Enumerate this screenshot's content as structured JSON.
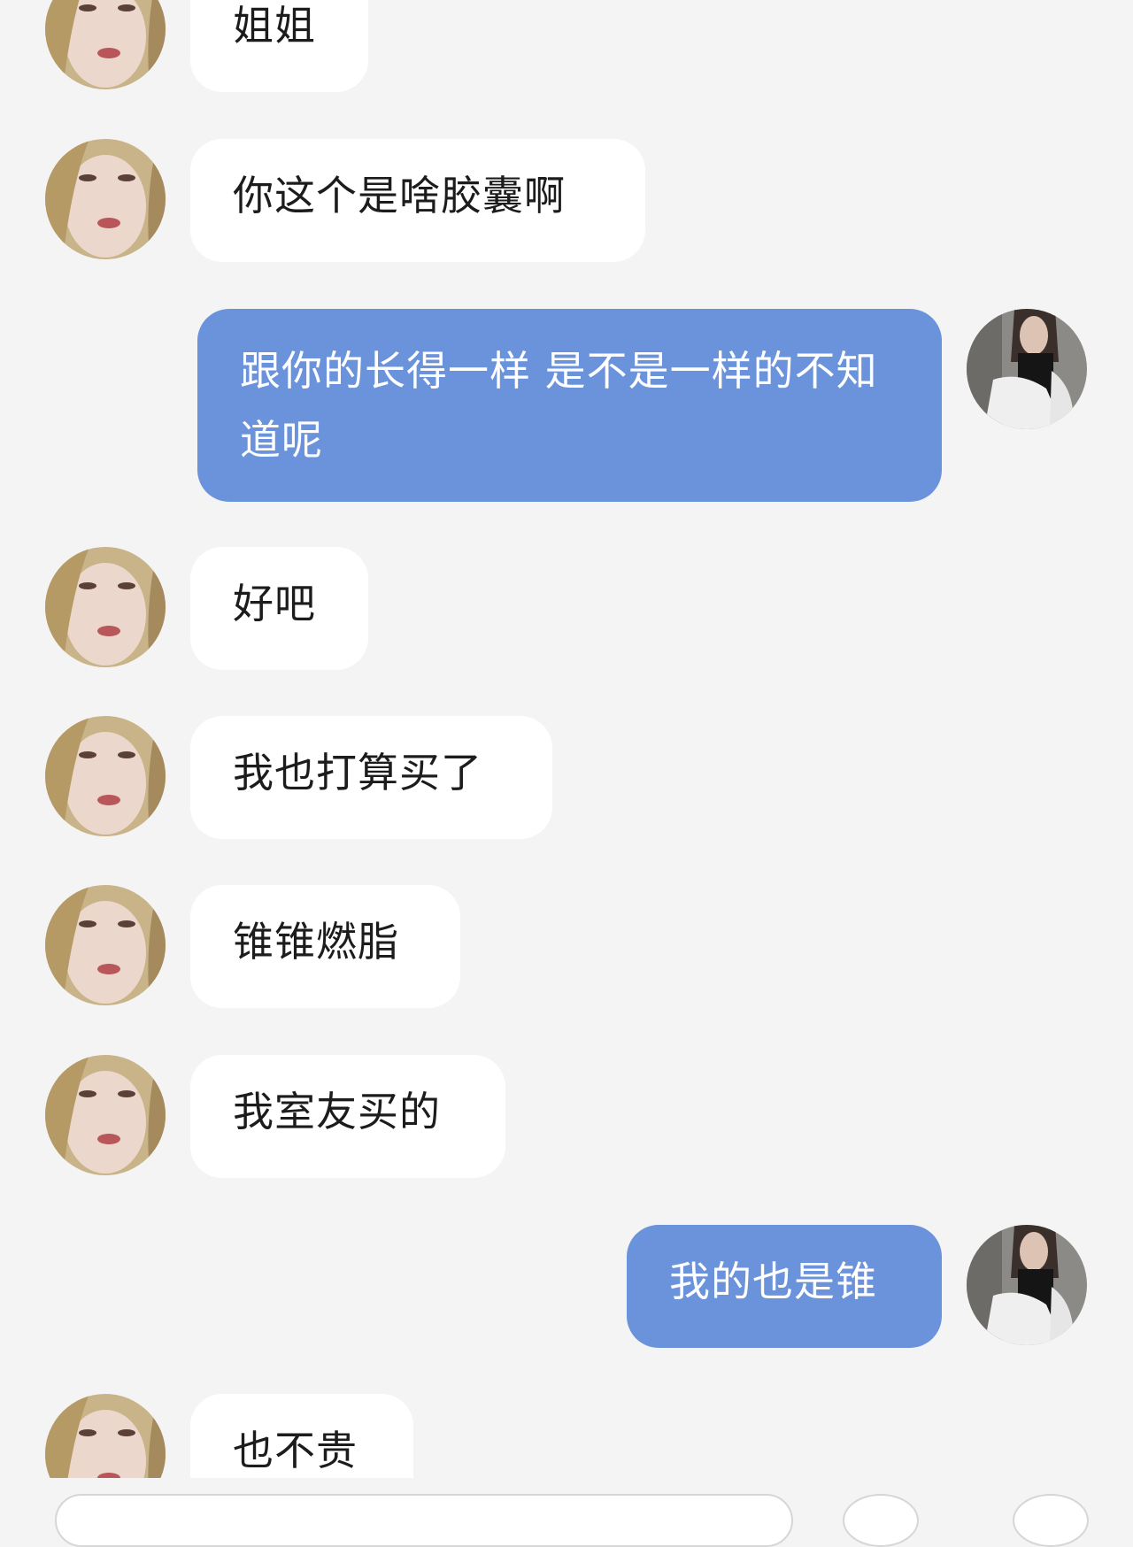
{
  "messages": [
    {
      "id": 1,
      "side": "in",
      "text": "姐姐"
    },
    {
      "id": 2,
      "side": "in",
      "text": "你这个是啥胶囊啊"
    },
    {
      "id": 3,
      "side": "out",
      "text": "跟你的长得一样 是不是一样的不知道呢"
    },
    {
      "id": 4,
      "side": "in",
      "text": "好吧"
    },
    {
      "id": 5,
      "side": "in",
      "text": "我也打算买了"
    },
    {
      "id": 6,
      "side": "in",
      "text": "锥锥燃脂"
    },
    {
      "id": 7,
      "side": "in",
      "text": "我室友买的"
    },
    {
      "id": 8,
      "side": "out",
      "text": "我的也是锥"
    },
    {
      "id": 9,
      "side": "in",
      "text": "也不贵"
    }
  ],
  "colors": {
    "background": "#f4f4f4",
    "incoming_bubble": "#ffffff",
    "outgoing_bubble": "#6a93dc",
    "incoming_text": "#1c1c1c",
    "outgoing_text": "#ffffff"
  },
  "icons": {
    "incoming_avatar": "contact-avatar-blonde",
    "outgoing_avatar": "own-avatar-dark-hair"
  }
}
